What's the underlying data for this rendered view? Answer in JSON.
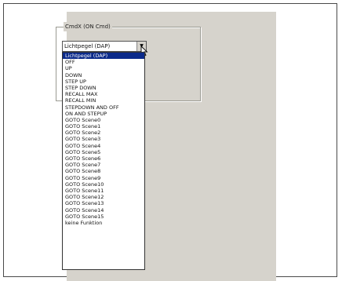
{
  "dialog": {
    "groupbox_label": "CmdX (ON Cmd)",
    "combo_value": "Lichtpegel (DAP)",
    "combo_arrow": "▼",
    "selected_index": 0,
    "options": [
      "Lichtpegel (DAP)",
      "OFF",
      "UP",
      "DOWN",
      "STEP UP",
      "STEP DOWN",
      "RECALL MAX",
      "RECALL MIN",
      "STEPDOWN AND OFF",
      "ON AND STEPUP",
      "GOTO Scene0",
      "GOTO Scene1",
      "GOTO Scene2",
      "GOTO Scene3",
      "GOTO Scene4",
      "GOTO Scene5",
      "GOTO Scene6",
      "GOTO Scene7",
      "GOTO Scene8",
      "GOTO Scene9",
      "GOTO Scene10",
      "GOTO Scene11",
      "GOTO Scene12",
      "GOTO Scene13",
      "GOTO Scene14",
      "GOTO Scene15",
      "keine Funktion"
    ]
  },
  "colors": {
    "panel": "#d6d3cc",
    "selection": "#0b2a8a"
  }
}
